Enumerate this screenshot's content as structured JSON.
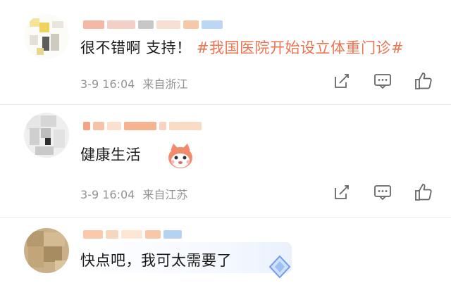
{
  "comments": [
    {
      "text": "很不错啊 支持！",
      "hashtag": "#我国医院开始设立体重门诊#",
      "date": "3-9 16:04",
      "location": "来自浙江"
    },
    {
      "text": "健康生活",
      "date": "3-9 16:04",
      "location": "来自江苏"
    },
    {
      "text": "快点吧，我可太需要了"
    }
  ],
  "icons": {
    "share": "share-icon",
    "comment": "comment-icon",
    "like": "like-icon"
  },
  "colors": {
    "hashtag": "#eb7350",
    "meta": "#939393"
  }
}
